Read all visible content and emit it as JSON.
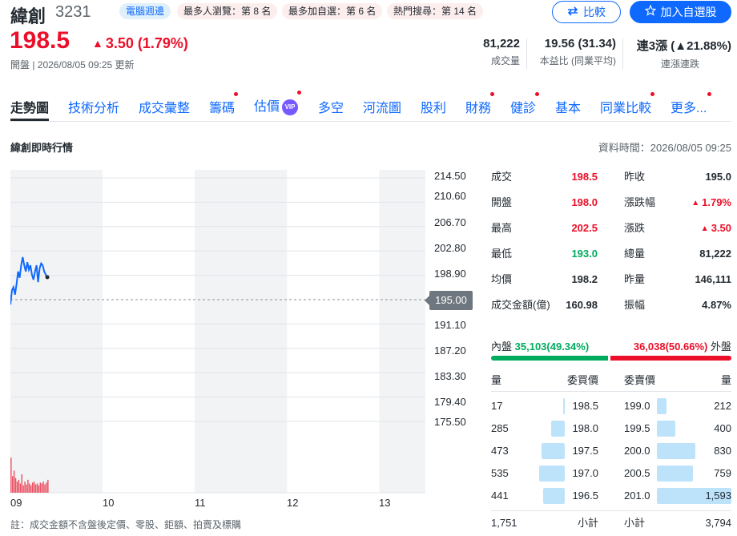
{
  "stock": {
    "name": "緯創",
    "code": "3231",
    "badges": [
      "電腦週邊",
      "最多人瀏覽：第 8 名",
      "最多加自選：第 6 名",
      "熱門搜尋：第 14 名"
    ],
    "price": "198.5",
    "change": "3.50 (1.79%)",
    "status": "開盤 | 2026/08/05 09:25 更新"
  },
  "buttons": {
    "compare": "比較",
    "add_watchlist": "加入自選股"
  },
  "stats": [
    {
      "value": "81,222",
      "label": "成交量"
    },
    {
      "value": "19.56 (31.34)",
      "label": "本益比 (同業平均)"
    },
    {
      "value": "連3漲 (▲21.88%)",
      "label": "連漲連跌"
    }
  ],
  "tabs": [
    "走勢圖",
    "技術分析",
    "成交彙整",
    "籌碼",
    "估價",
    "多空",
    "河流圖",
    "股利",
    "財務",
    "健診",
    "基本",
    "同業比較",
    "更多..."
  ],
  "vip_label": "VIP",
  "section_title": "緯創即時行情",
  "data_time": "資料時間：2026/08/05 09:25",
  "chart_data": {
    "type": "line",
    "y_ticks": [
      "214.50",
      "210.60",
      "206.70",
      "202.80",
      "198.90",
      "195.00",
      "191.10",
      "187.20",
      "183.30",
      "179.40",
      "175.50"
    ],
    "x_ticks": [
      "09",
      "10",
      "11",
      "12",
      "13"
    ],
    "reference": 195.0,
    "reference_label": "195.00",
    "ylim": [
      175.5,
      214.5
    ],
    "xlim_minutes": [
      0,
      270
    ],
    "series": [
      {
        "values": [
          [
            0,
            194.2
          ],
          [
            1,
            196.5
          ],
          [
            2,
            197.0
          ],
          [
            3,
            195.8
          ],
          [
            4,
            197.5
          ],
          [
            5,
            199.5
          ],
          [
            6,
            198.5
          ],
          [
            7,
            200.5
          ],
          [
            8,
            201.8
          ],
          [
            9,
            200.5
          ],
          [
            10,
            199.5
          ],
          [
            11,
            201.0
          ],
          [
            12,
            199.8
          ],
          [
            13,
            200.5
          ],
          [
            14,
            199.0
          ],
          [
            15,
            198.2
          ],
          [
            16,
            199.5
          ],
          [
            17,
            200.5
          ],
          [
            18,
            197.8
          ],
          [
            19,
            200.0
          ],
          [
            20,
            200.8
          ],
          [
            21,
            200.5
          ],
          [
            22,
            199.5
          ],
          [
            23,
            199.0
          ],
          [
            24,
            198.6
          ]
        ]
      }
    ],
    "volume": [
      38,
      18,
      24,
      16,
      12,
      14,
      10,
      20,
      8,
      12,
      9,
      14,
      10,
      8,
      11,
      12,
      9,
      10,
      8,
      11,
      10,
      12,
      9,
      11,
      14
    ],
    "volume_max": 72
  },
  "quote": {
    "left": [
      {
        "label": "成交",
        "value": "198.5",
        "color": "red"
      },
      {
        "label": "開盤",
        "value": "198.0",
        "color": "red"
      },
      {
        "label": "最高",
        "value": "202.5",
        "color": "red"
      },
      {
        "label": "最低",
        "value": "193.0",
        "color": "green"
      },
      {
        "label": "均價",
        "value": "198.2",
        "color": "dark"
      },
      {
        "label": "成交金額(億)",
        "value": "160.98",
        "color": "dark"
      }
    ],
    "right": [
      {
        "label": "昨收",
        "value": "195.0",
        "color": "dark"
      },
      {
        "label": "漲跌幅",
        "value": "1.79%",
        "color": "red",
        "arrow": true
      },
      {
        "label": "漲跌",
        "value": "3.50",
        "color": "red",
        "arrow": true
      },
      {
        "label": "總量",
        "value": "81,222",
        "color": "dark"
      },
      {
        "label": "昨量",
        "value": "146,111",
        "color": "dark"
      },
      {
        "label": "振幅",
        "value": "4.87%",
        "color": "dark"
      }
    ]
  },
  "inout": {
    "inner_label": "內盤",
    "inner_value": "35,103(49.34%)",
    "outer_value": "36,038(50.66%)",
    "outer_label": "外盤",
    "inner_ratio": 0.4934
  },
  "orderbook": {
    "head": {
      "qty": "量",
      "bid": "委買價",
      "ask": "委賣價",
      "qty2": "量"
    },
    "bids": [
      {
        "qty": "17",
        "price": "198.5",
        "fill": 0.01
      },
      {
        "qty": "285",
        "price": "198.0",
        "fill": 0.18
      },
      {
        "qty": "473",
        "price": "197.5",
        "fill": 0.3
      },
      {
        "qty": "535",
        "price": "197.0",
        "fill": 0.34
      },
      {
        "qty": "441",
        "price": "196.5",
        "fill": 0.28
      }
    ],
    "asks": [
      {
        "price": "199.0",
        "qty": "212",
        "fill": 0.13
      },
      {
        "price": "199.5",
        "qty": "400",
        "fill": 0.25
      },
      {
        "price": "200.0",
        "qty": "830",
        "fill": 0.52
      },
      {
        "price": "200.5",
        "qty": "759",
        "fill": 0.48
      },
      {
        "price": "201.0",
        "qty": "1,593",
        "fill": 1.0
      }
    ],
    "total_bid": "1,751",
    "total_label": "小計",
    "total_ask": "3,794"
  },
  "note": "註：成交金額不含盤後定價、零股、鉅額、拍賣及標購",
  "colors": {
    "up": "#eb0f29",
    "down": "#00ab5e",
    "accent": "#0f69ff",
    "line": "#0f69ff"
  }
}
